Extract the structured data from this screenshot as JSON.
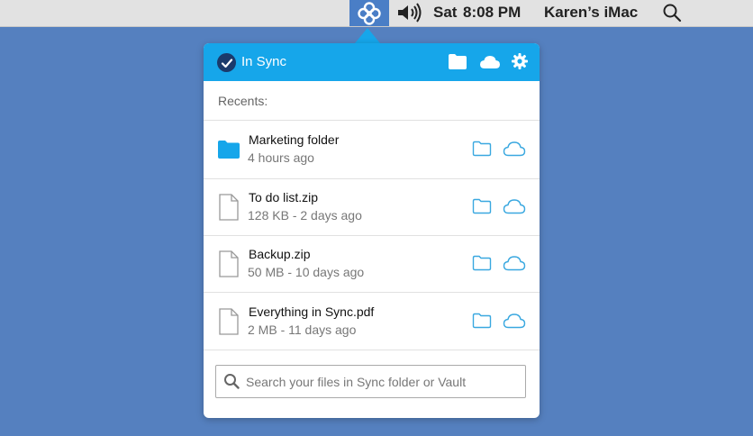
{
  "menubar": {
    "app_icon": "sync-app-icon",
    "volume_icon": "volume-icon",
    "day": "Sat",
    "time": "8:08 PM",
    "user": "Karen’s iMac",
    "spotlight_icon": "magnifier-icon"
  },
  "popup": {
    "status_label": "In Sync",
    "status_icon": "check-circle-icon",
    "header_icons": [
      "folder-icon",
      "cloud-icon",
      "gear-icon"
    ],
    "recents_label": "Recents:",
    "items": [
      {
        "name": "Marketing folder",
        "meta": "4 hours ago",
        "type": "folder"
      },
      {
        "name": "To do list.zip",
        "meta": "128 KB - 2 days ago",
        "type": "file"
      },
      {
        "name": "Backup.zip",
        "meta": "50 MB - 10 days ago",
        "type": "file"
      },
      {
        "name": "Everything in Sync.pdf",
        "meta": "2 MB - 11 days ago",
        "type": "file"
      }
    ],
    "search": {
      "placeholder": "Search your files in Sync folder or Vault",
      "value": ""
    }
  },
  "colors": {
    "desktop": "#5580bf",
    "accent": "#16a6ea",
    "check_badge": "#1b3a6b",
    "action_icon": "#3aa8e0"
  }
}
